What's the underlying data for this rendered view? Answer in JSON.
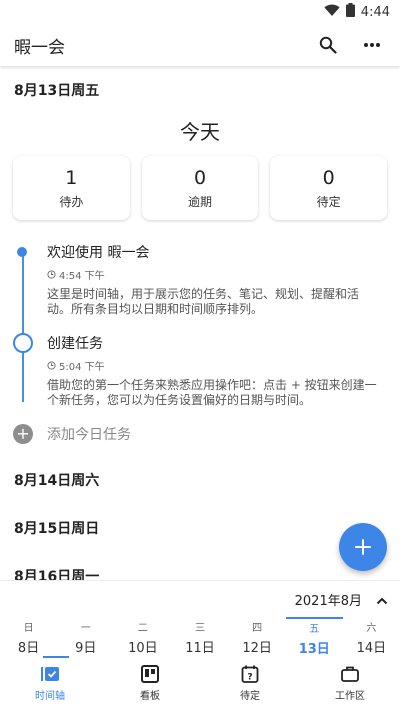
{
  "status": {
    "time": "4:44"
  },
  "appbar": {
    "title": "暇一会"
  },
  "sections": [
    {
      "date": "8月13日周五"
    },
    {
      "date": "8月14日周六"
    },
    {
      "date": "8月15日周日"
    },
    {
      "date": "8月16日周一"
    }
  ],
  "today": {
    "title": "今天",
    "stats": [
      {
        "value": "1",
        "label": "待办"
      },
      {
        "value": "0",
        "label": "逾期"
      },
      {
        "value": "0",
        "label": "待定"
      }
    ],
    "items": [
      {
        "title": "欢迎使用 暇一会",
        "time": "4:54 下午",
        "desc": "这里是时间轴，用于展示您的任务、笔记、规划、提醒和活动。所有条目均以日期和时间顺序排列。"
      },
      {
        "title": "创建任务",
        "time": "5:04 下午",
        "desc": "借助您的第一个任务来熟悉应用操作吧：点击 + 按钮来创建一个新任务，您可以为任务设置偏好的日期与时间。"
      }
    ],
    "add_label": "添加今日任务"
  },
  "calendar": {
    "month": "2021年8月",
    "days": [
      {
        "weekday": "日",
        "date": "8日"
      },
      {
        "weekday": "一",
        "date": "9日"
      },
      {
        "weekday": "二",
        "date": "10日"
      },
      {
        "weekday": "三",
        "date": "11日"
      },
      {
        "weekday": "四",
        "date": "12日"
      },
      {
        "weekday": "五",
        "date": "13日"
      },
      {
        "weekday": "六",
        "date": "14日"
      }
    ]
  },
  "nav": [
    {
      "label": "时间轴"
    },
    {
      "label": "看板"
    },
    {
      "label": "待定"
    },
    {
      "label": "工作区"
    }
  ],
  "colors": {
    "accent": "#3d86e8"
  }
}
